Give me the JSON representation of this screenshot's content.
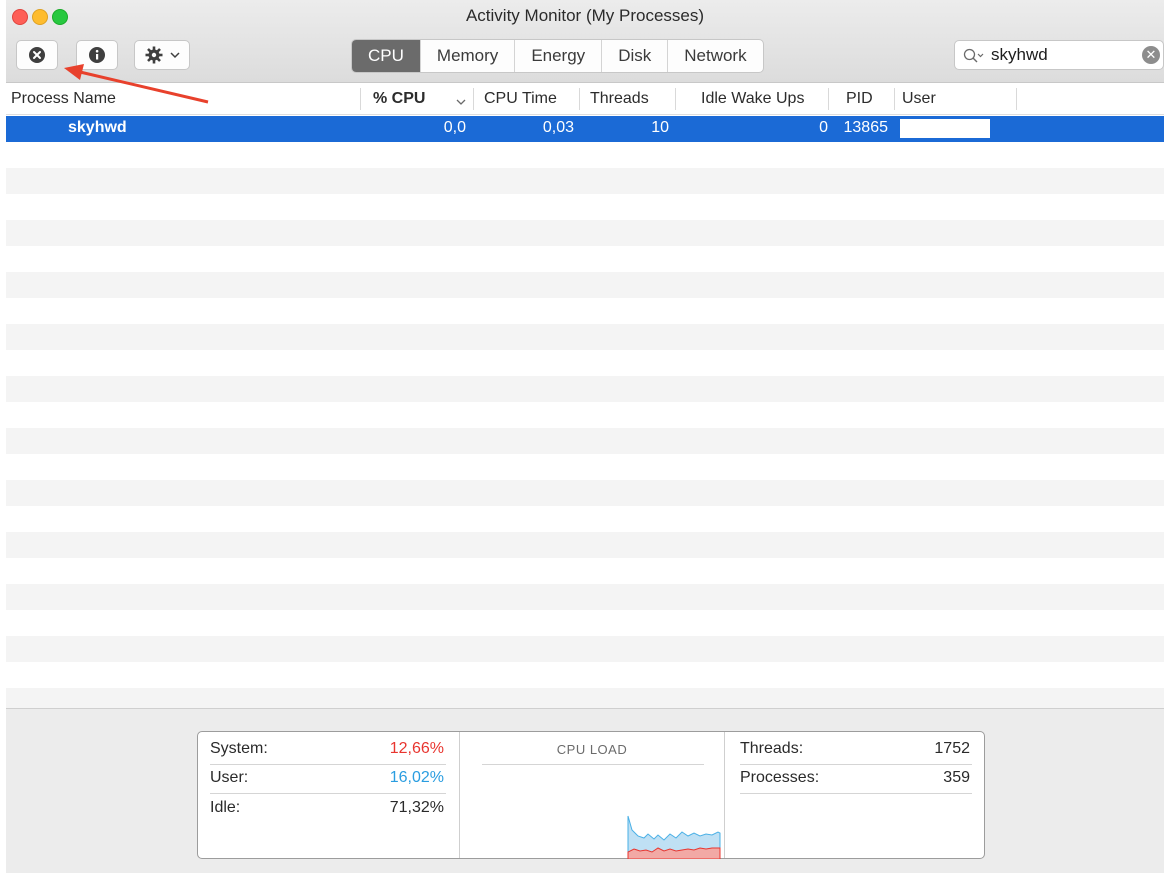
{
  "window": {
    "title": "Activity Monitor (My Processes)"
  },
  "tabs": [
    {
      "label": "CPU",
      "active": true
    },
    {
      "label": "Memory",
      "active": false
    },
    {
      "label": "Energy",
      "active": false
    },
    {
      "label": "Disk",
      "active": false
    },
    {
      "label": "Network",
      "active": false
    }
  ],
  "toolbar": {
    "stop_icon": "x-circle-icon",
    "info_icon": "info-icon",
    "gear_icon": "gear-icon"
  },
  "search": {
    "value": "skyhwd",
    "icon": "search-icon",
    "clear_icon": "clear-icon"
  },
  "columns": {
    "process_name": "Process Name",
    "cpu_pct": "% CPU",
    "cpu_time": "CPU Time",
    "threads": "Threads",
    "idle_wake_ups": "Idle Wake Ups",
    "pid": "PID",
    "user": "User"
  },
  "process": {
    "name": "skyhwd",
    "cpu_pct": "0,0",
    "cpu_time": "0,03",
    "threads": "10",
    "idle_wake_ups": "0",
    "pid": "13865"
  },
  "stats": {
    "system_label": "System:",
    "system_value": "12,66%",
    "user_label": "User:",
    "user_value": "16,02%",
    "idle_label": "Idle:",
    "idle_value": "71,32%",
    "cpu_load_title": "CPU LOAD",
    "threads_label": "Threads:",
    "threads_value": "1752",
    "processes_label": "Processes:",
    "processes_value": "359"
  },
  "colors": {
    "selection": "#1b6ad6",
    "system": "#e8352f",
    "user": "#2a9de0",
    "annotation_arrow": "#e8412c"
  }
}
